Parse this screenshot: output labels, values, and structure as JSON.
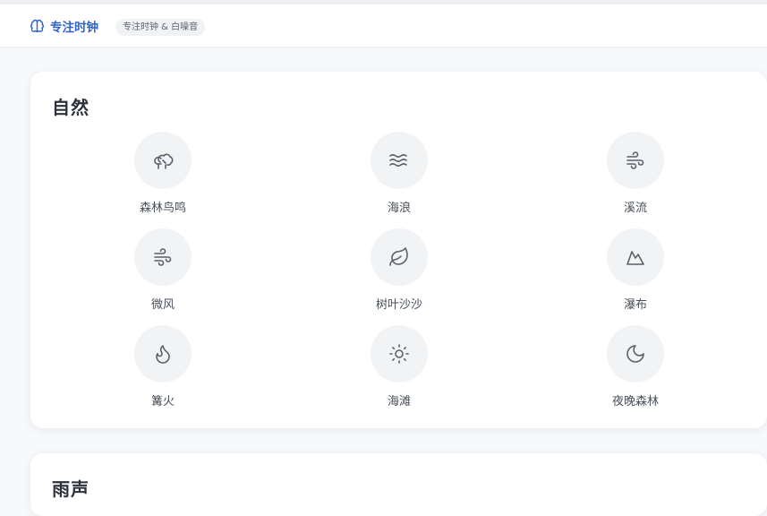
{
  "header": {
    "brand_icon": "brain-icon",
    "title": "专注时钟",
    "tag": "专注时钟 & 白噪音",
    "accent_color": "#2f63c9"
  },
  "sections": [
    {
      "title": "自然",
      "sounds": [
        {
          "label": "森林鸟鸣",
          "icon": "trees-icon"
        },
        {
          "label": "海浪",
          "icon": "waves-icon"
        },
        {
          "label": "溪流",
          "icon": "wind-icon"
        },
        {
          "label": "微风",
          "icon": "wind-icon"
        },
        {
          "label": "树叶沙沙",
          "icon": "leaf-icon"
        },
        {
          "label": "瀑布",
          "icon": "mountain-icon"
        },
        {
          "label": "篝火",
          "icon": "flame-icon"
        },
        {
          "label": "海滩",
          "icon": "sun-icon"
        },
        {
          "label": "夜晚森林",
          "icon": "moon-icon"
        }
      ]
    },
    {
      "title": "雨声"
    }
  ]
}
